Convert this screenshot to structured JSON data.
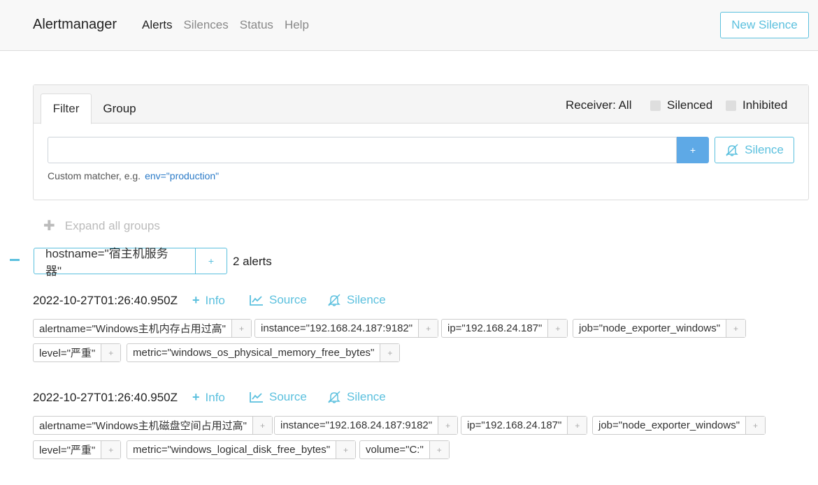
{
  "navbar": {
    "brand": "Alertmanager",
    "links": [
      "Alerts",
      "Silences",
      "Status",
      "Help"
    ],
    "new_silence": "New Silence"
  },
  "filter": {
    "tabs": [
      "Filter",
      "Group"
    ],
    "receiver": "Receiver: All",
    "silenced": "Silenced",
    "inhibited": "Inhibited",
    "input_value": "",
    "add": "+",
    "silence": "Silence",
    "hint": "Custom matcher, e.g.",
    "hint_example": "env=\"production\""
  },
  "expand_all": "Expand all groups",
  "group": {
    "label": "hostname=\"宿主机服务器\"",
    "add": "+",
    "count": "2 alerts"
  },
  "alert_actions": {
    "info": "Info",
    "source": "Source",
    "silence": "Silence"
  },
  "alerts": [
    {
      "timestamp": "2022-10-27T01:26:40.950Z",
      "labels": [
        "alertname=\"Windows主机内存占用过高\"",
        "instance=\"192.168.24.187:9182\"",
        "ip=\"192.168.24.187\"",
        "job=\"node_exporter_windows\"",
        "level=\"严重\"",
        "metric=\"windows_os_physical_memory_free_bytes\""
      ]
    },
    {
      "timestamp": "2022-10-27T01:26:40.950Z",
      "labels": [
        "alertname=\"Windows主机磁盘空间占用过高\"",
        "instance=\"192.168.24.187:9182\"",
        "ip=\"192.168.24.187\"",
        "job=\"node_exporter_windows\"",
        "level=\"严重\"",
        "metric=\"windows_logical_disk_free_bytes\"",
        "volume=\"C:\""
      ]
    }
  ],
  "label_add": "+",
  "colors": {
    "accent": "#5bc0de",
    "primary": "#5ea9e6",
    "link": "#2a7ac7"
  }
}
